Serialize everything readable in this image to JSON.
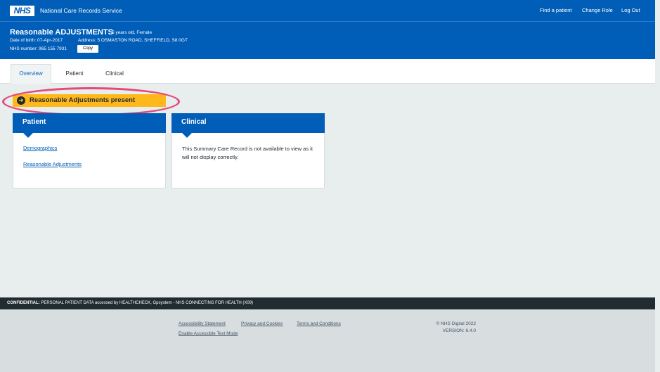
{
  "header": {
    "logo": "NHS",
    "service_name": "National Care Records Service",
    "links": [
      "Find a patient",
      "Change Role",
      "Log Out"
    ]
  },
  "patient_banner": {
    "name": "Reasonable ADJUSTMENTS",
    "age_gender": "5 years old, Female",
    "dob": "Date of birth: 07-Apr-2017",
    "address": "Address: 5 OSMASTON ROAD, SHEFFIELD, S8 0GT",
    "nhs_number": "NHS number: 965 155 7931",
    "copy_label": "Copy"
  },
  "tabs": [
    {
      "label": "Overview",
      "active": true
    },
    {
      "label": "Patient",
      "active": false
    },
    {
      "label": "Clinical",
      "active": false
    }
  ],
  "alert": {
    "text": "Reasonable Adjustments present",
    "icon": "arrow-right-circle-icon"
  },
  "cards": {
    "patient": {
      "title": "Patient",
      "links": [
        "Demographics",
        "Reasonable Adjustments"
      ]
    },
    "clinical": {
      "title": "Clinical",
      "message": "This Summary Care Record is not available to view as it will not display correctly."
    }
  },
  "confidential": {
    "label": "CONFIDENTIAL:",
    "text": "PERSONAL PATIENT DATA accessed by HEALTHCHECK, Gpsystem - NHS CONNECTING FOR HEALTH (X09)"
  },
  "footer": {
    "links": [
      "Accessibility Statement",
      "Privacy and Cookies",
      "Terms and Conditions",
      "Enable Accessible Text Mode"
    ],
    "copyright": "© NHS Digital 2022",
    "version": "VERSION: 6.4.0"
  },
  "colors": {
    "nhs_blue": "#005eb8",
    "alert_yellow": "#ffb81c",
    "highlight_pink": "#e4497a",
    "dark": "#212b32"
  }
}
